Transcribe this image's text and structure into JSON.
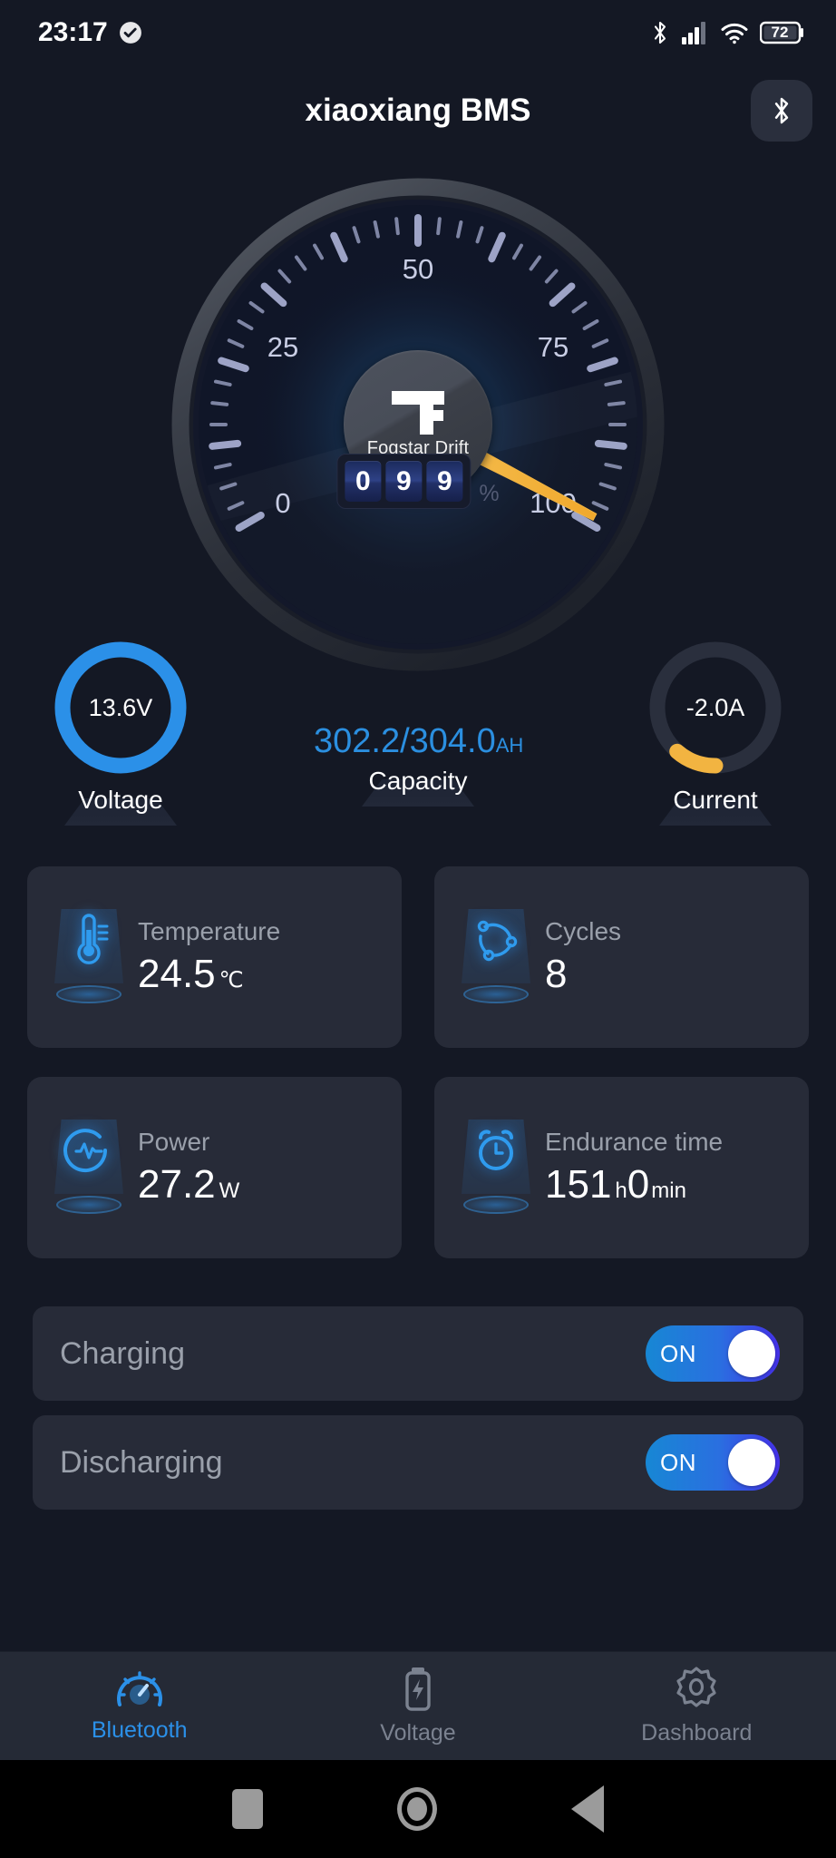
{
  "statusbar": {
    "time": "23:17",
    "check_icon": "check-circle-icon",
    "bluetooth_icon": "bluetooth-icon",
    "signal_icon": "cellular-signal-icon",
    "wifi_icon": "wifi-icon",
    "battery_icon": "battery-icon",
    "battery_percent": "72"
  },
  "titlebar": {
    "title": "xiaoxiang BMS",
    "bluetooth_button_icon": "bluetooth-icon"
  },
  "gauge": {
    "brand": "Fogstar Drift",
    "logo_icon": "fogstar-f-logo-icon",
    "tick_labels": [
      "0",
      "25",
      "50",
      "75",
      "100"
    ],
    "min": 0,
    "max": 100,
    "needle_value": 99,
    "needle_color": "#f2b441",
    "odometer_digits": [
      "0",
      "9",
      "9"
    ],
    "odometer_unit": "%"
  },
  "meters": {
    "voltage": {
      "value": "13.6V",
      "label": "Voltage",
      "ring_color": "#2b90e8",
      "ring_percent": 100
    },
    "capacity": {
      "value": "302.2/304.0",
      "unit": "AH",
      "label": "Capacity",
      "color": "#2b8fe0"
    },
    "current": {
      "value": "-2.0A",
      "label": "Current",
      "ring_color": "#f2b441",
      "track_color": "#2a2f3d",
      "ring_percent": 12
    }
  },
  "cards": [
    {
      "icon": "thermometer-icon",
      "title": "Temperature",
      "value": "24.5",
      "unit": "℃"
    },
    {
      "icon": "cycles-icon",
      "title": "Cycles",
      "value": "8",
      "unit": ""
    },
    {
      "icon": "power-pulse-icon",
      "title": "Power",
      "value": "27.2",
      "unit": "W"
    },
    {
      "icon": "alarm-clock-icon",
      "title": "Endurance time",
      "value": "151",
      "unit": "h",
      "value2": "0",
      "unit2": "min"
    }
  ],
  "toggles": [
    {
      "label": "Charging",
      "state": "ON"
    },
    {
      "label": "Discharging",
      "state": "ON"
    }
  ],
  "bottomnav": [
    {
      "icon": "speedometer-icon",
      "label": "Bluetooth",
      "active": true
    },
    {
      "icon": "battery-bolt-icon",
      "label": "Voltage",
      "active": false
    },
    {
      "icon": "gear-icon",
      "label": "Dashboard",
      "active": false
    }
  ],
  "sysbar": {
    "recents_icon": "recents-square-icon",
    "home_icon": "home-circle-icon",
    "back_icon": "back-triangle-icon"
  }
}
